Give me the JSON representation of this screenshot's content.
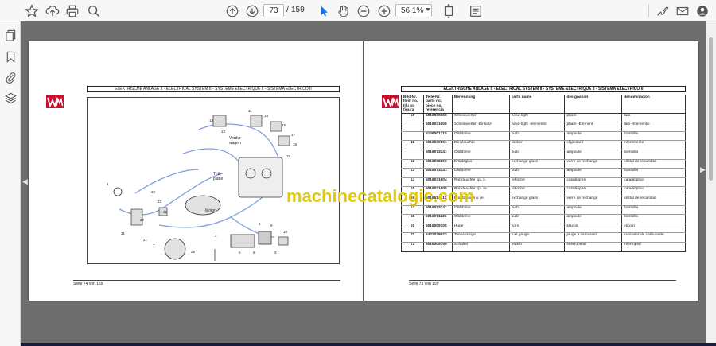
{
  "toolbar": {
    "page_current": "73",
    "page_separator": "/",
    "page_total": "159",
    "zoom": "56,1%",
    "icons": [
      "star-icon",
      "upload-icon",
      "print-icon",
      "zoom-search-icon",
      "page-up-icon",
      "page-down-icon",
      "select-cursor-icon",
      "hand-icon",
      "zoom-out-icon",
      "zoom-in-icon",
      "fit-page-icon",
      "read-mode-icon",
      "sign-icon",
      "email-icon",
      "account-icon"
    ]
  },
  "sidebar": {
    "icons": [
      "pages-icon",
      "bookmark-icon",
      "attachment-icon",
      "layers-icon"
    ]
  },
  "accent_color": "#1473e6",
  "watermark": "machinecatalogic.com",
  "left_page": {
    "title": "ELEKTRISCHE ANLAGE II - ELECTRICAL SYSTEM II - SYSTEME ELECTRIQUE II - SISTEMA ELECTRICO II",
    "footer": "Seite 74 von 159",
    "diagram_labels": {
      "vorderwagen": "Vorder-\nwagen",
      "trittplatte": "Tritt-\nplatte",
      "motor": "Motor",
      "callouts": [
        "4",
        "23",
        "20",
        "21",
        "22",
        "21",
        "21",
        "25",
        "1",
        "2",
        "12",
        "13",
        "11",
        "14",
        "15",
        "17",
        "18",
        "19",
        "8",
        "9",
        "10",
        "5",
        "6",
        "3"
      ]
    }
  },
  "right_page": {
    "title": "ELEKTRISCHE ANLAGE II - ELECTRICAL SYSTEM II - SYSTEME ELECTRIQUE II - SISTEMA ELECTRICO II",
    "footer": "Seite 75 von 159",
    "headers": [
      "Bild-Nr. Item no. Illu no figura",
      "Teile-Nr. parts no. pièce no. referencia",
      "Benennung",
      "parts name",
      "désignation",
      "denominación"
    ],
    "rows": [
      [
        "10",
        "5016030600",
        "Scheinwerfer",
        "head-light",
        "phare",
        "faro"
      ],
      [
        "",
        "5016031608",
        "Scheinwerfer -Einsatz-",
        "head-light -elements-",
        "phare -Elément-",
        "faro -Elemento-"
      ],
      [
        "",
        "5106001215",
        "Glühbirne",
        "bulb",
        "ampoule",
        "bombilla"
      ],
      [
        "11",
        "5016030601",
        "Blinkleuchte",
        "blinker",
        "clignotant",
        "intermitente"
      ],
      [
        "",
        "5016073241",
        "Glühbirne",
        "bulb",
        "ampoule",
        "bombilla"
      ],
      [
        "12",
        "5016000290",
        "Ersatzglas",
        "exchange glass",
        "verre de rechange",
        "cristal de recambio"
      ],
      [
        "13",
        "5016073241",
        "Glühbirne",
        "bulb",
        "ampoule",
        "bombilla"
      ],
      [
        "14",
        "5016031604",
        "Rückleuchte kpl. li.",
        "reflector",
        "catadioptre",
        "catadióptico"
      ],
      [
        "15",
        "5016031605",
        "Rückleuchte kpl. re.",
        "reflector",
        "catadioptre",
        "catadióptico"
      ],
      [
        "16",
        "5016614011",
        "Ersatzglas li u. re.",
        "exchange glass",
        "verre de rechange",
        "cristal de recambio"
      ],
      [
        "17",
        "5016073241",
        "Glühbirne",
        "bulb",
        "ampoule",
        "bombilla"
      ],
      [
        "18",
        "5016071131",
        "Glühbirne",
        "bulb",
        "ampoule",
        "bombilla"
      ],
      [
        "19",
        "5016009100",
        "Hupe",
        "horn",
        "klaxon",
        "claxón"
      ],
      [
        "20",
        "5432029822",
        "Tankanzeige",
        "fuel gauge",
        "jauge à carburant",
        "indicador de carburante"
      ],
      [
        "21",
        "5016009799",
        "Schalter",
        "switch",
        "interrupteur",
        "interruptor"
      ]
    ]
  }
}
